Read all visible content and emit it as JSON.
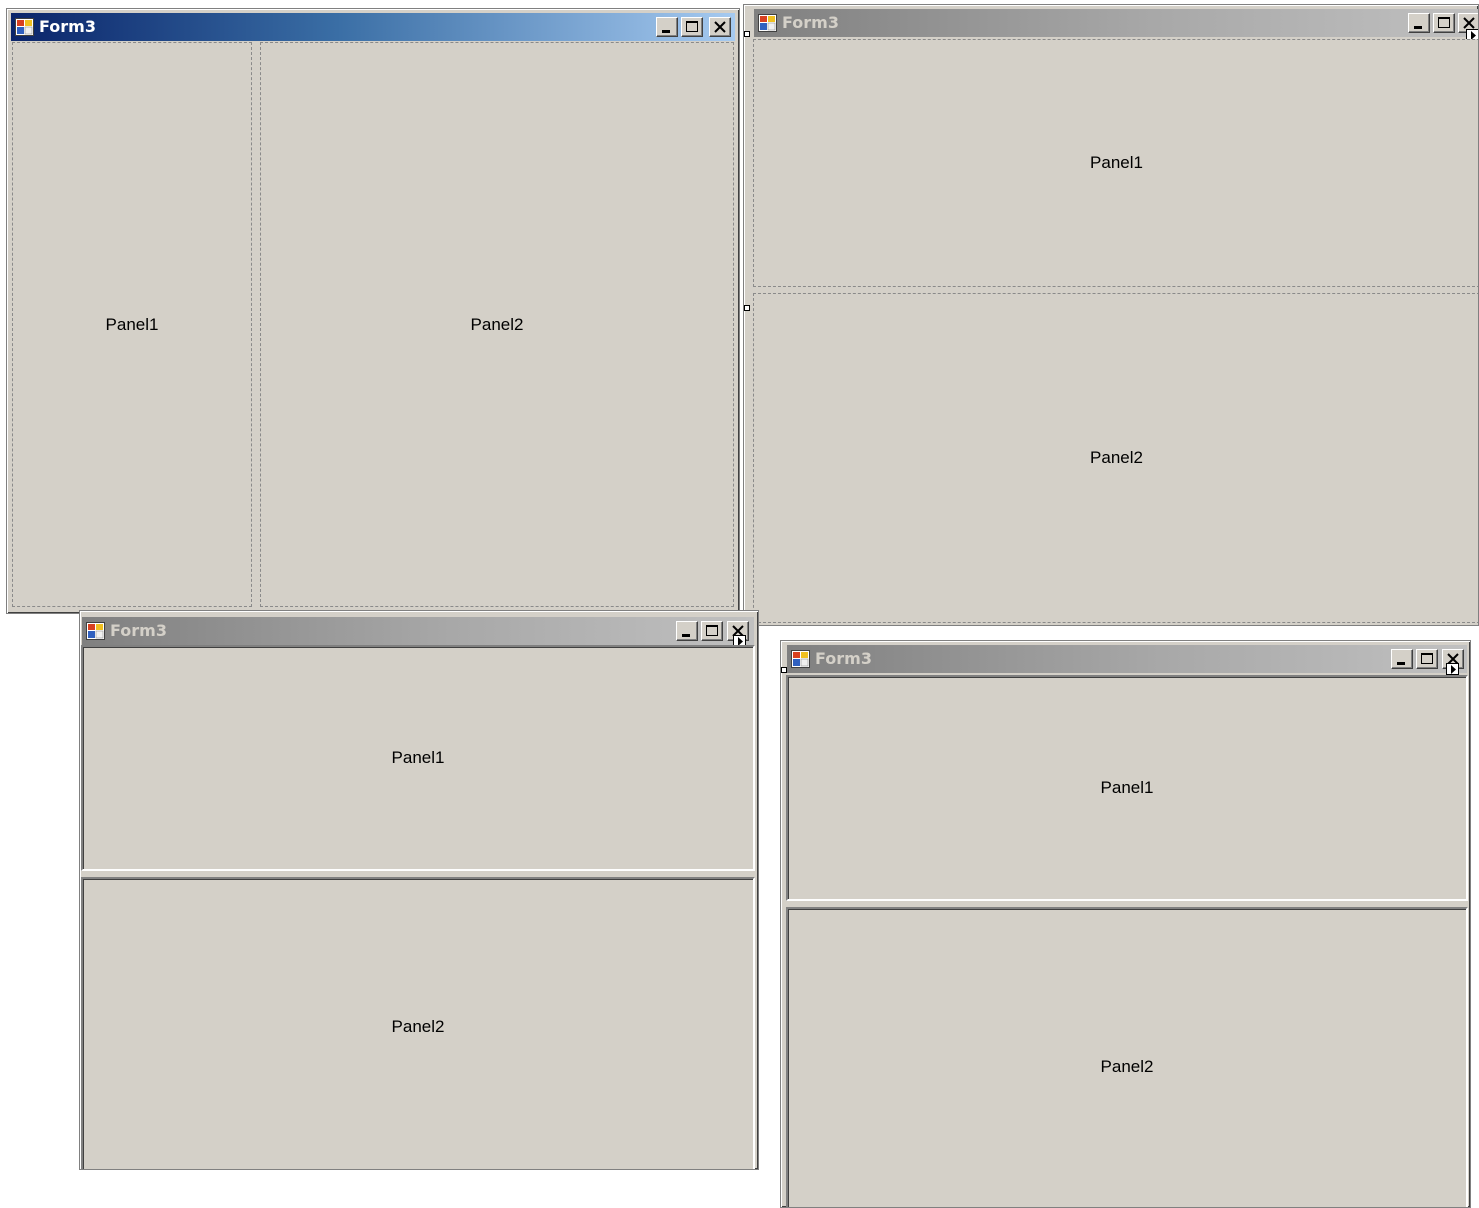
{
  "colors": {
    "form_face": "#d4d0c8",
    "active_title_start": "#0a246a",
    "active_title_end": "#a6caf0",
    "inactive_title_start": "#808080",
    "inactive_title_end": "#c0c0c0",
    "panel_border_dashed": "#8a8a8a"
  },
  "forms": [
    {
      "title": "Form3",
      "state": "active",
      "orientation": "vertical",
      "panel_border": "dashed",
      "panels": [
        {
          "label": "Panel1"
        },
        {
          "label": "Panel2"
        }
      ],
      "icons": [
        "form-app-icon",
        "minimize-icon",
        "maximize-icon",
        "close-icon"
      ]
    },
    {
      "title": "Form3",
      "state": "inactive",
      "orientation": "horizontal",
      "panel_border": "dashed",
      "panels": [
        {
          "label": "Panel1"
        },
        {
          "label": "Panel2"
        }
      ],
      "icons": [
        "form-app-icon",
        "minimize-icon",
        "maximize-icon",
        "close-icon",
        "smart-tag-arrow-icon"
      ]
    },
    {
      "title": "Form3",
      "state": "inactive",
      "orientation": "horizontal",
      "panel_border": "fixed3d",
      "panels": [
        {
          "label": "Panel1"
        },
        {
          "label": "Panel2"
        }
      ],
      "icons": [
        "form-app-icon",
        "minimize-icon",
        "maximize-icon",
        "close-icon",
        "smart-tag-arrow-icon"
      ]
    },
    {
      "title": "Form3",
      "state": "inactive",
      "orientation": "horizontal",
      "panel_border": "fixed3d",
      "panels": [
        {
          "label": "Panel1"
        },
        {
          "label": "Panel2"
        }
      ],
      "icons": [
        "form-app-icon",
        "minimize-icon",
        "maximize-icon",
        "close-icon",
        "smart-tag-arrow-icon"
      ]
    }
  ]
}
